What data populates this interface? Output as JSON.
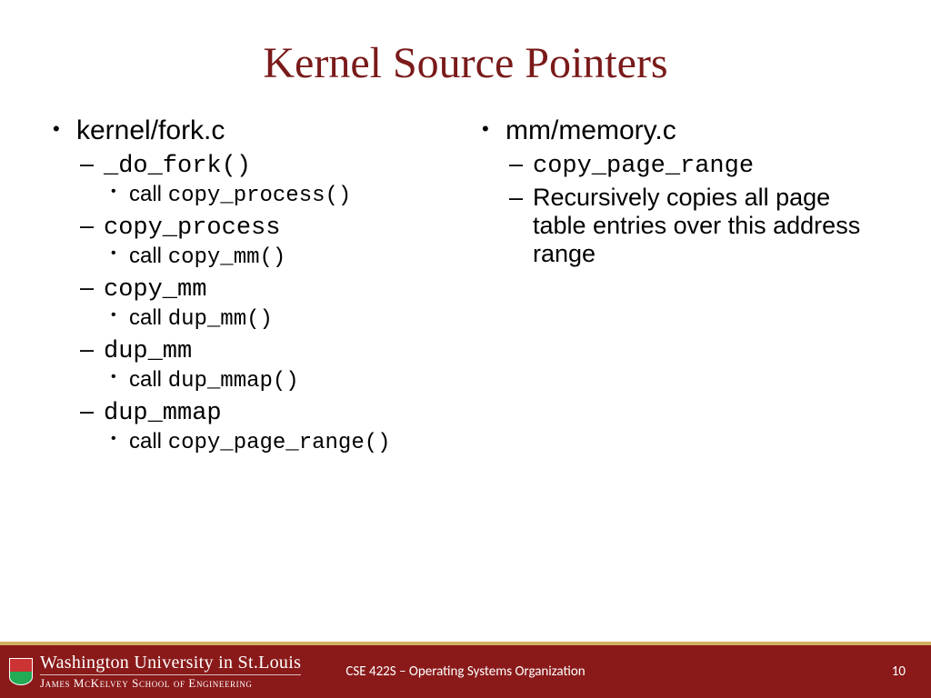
{
  "title": "Kernel Source Pointers",
  "left": {
    "heading": "kernel/fork.c",
    "items": [
      {
        "name": "_do_fork()",
        "call_prefix": "call  ",
        "call_fn": "copy_process()"
      },
      {
        "name": "copy_process",
        "call_prefix": "call ",
        "call_fn": "copy_mm()"
      },
      {
        "name": "copy_mm",
        "call_prefix": "call  ",
        "call_fn": "dup_mm()"
      },
      {
        "name": "dup_mm",
        "call_prefix": "call ",
        "call_fn": "dup_mmap()"
      },
      {
        "name": "dup_mmap",
        "call_prefix": "call ",
        "call_fn": "copy_page_range()"
      }
    ]
  },
  "right": {
    "heading": "mm/memory.c",
    "items": [
      {
        "name": "copy_page_range"
      },
      {
        "text": "Recursively copies all page table entries over this address range"
      }
    ]
  },
  "footer": {
    "university_main": "Washington University in St.Louis",
    "university_sub": "James McKelvey School of Engineering",
    "course": "CSE 422S – Operating Systems Organization",
    "page": "10"
  }
}
